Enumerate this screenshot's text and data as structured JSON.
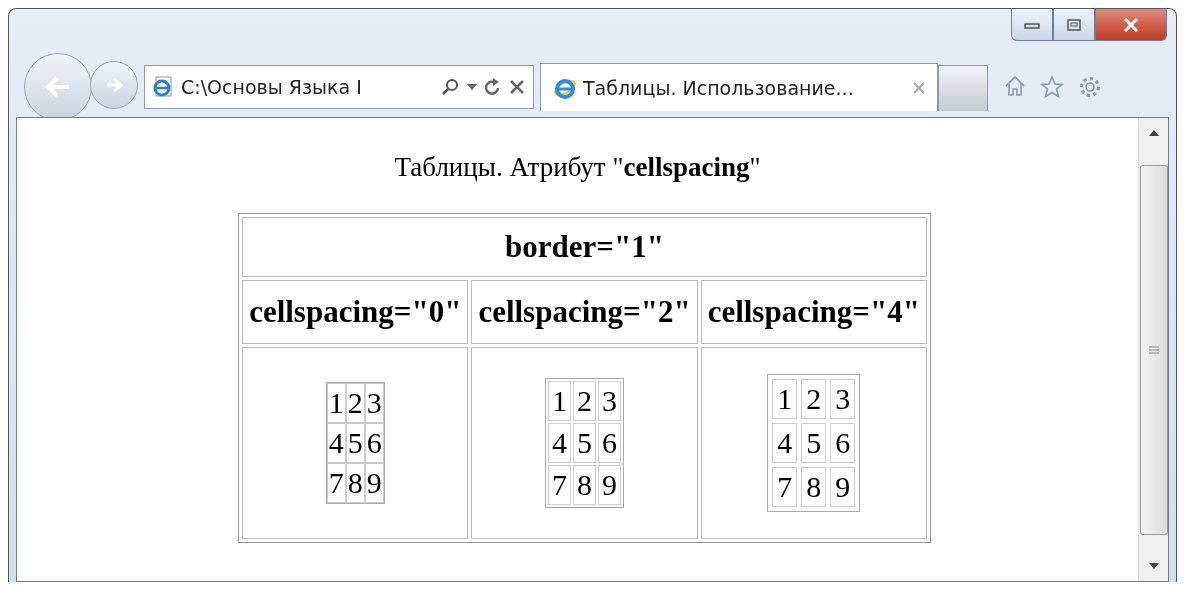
{
  "browser": {
    "address": "C:\\Основы Языка I",
    "tabs": [
      {
        "title": "Таблицы. Использование...",
        "selected": true
      }
    ]
  },
  "page": {
    "title": "Таблицы. Атрибут \"**cellspacing**\"",
    "table": {
      "caption": "border=\"1\"",
      "columns": [
        {
          "heading": "cellspacing=\"0\"",
          "kind": "tight",
          "cells": [
            "1",
            "2",
            "3",
            "4",
            "5",
            "6",
            "7",
            "8",
            "9"
          ]
        },
        {
          "heading": "cellspacing=\"2\"",
          "kind": "medium",
          "cells": [
            "1",
            "2",
            "3",
            "4",
            "5",
            "6",
            "7",
            "8",
            "9"
          ]
        },
        {
          "heading": "cellspacing=\"4\"",
          "kind": "wide",
          "cells": [
            "1",
            "2",
            "3",
            "4",
            "5",
            "6",
            "7",
            "8",
            "9"
          ]
        }
      ]
    }
  }
}
